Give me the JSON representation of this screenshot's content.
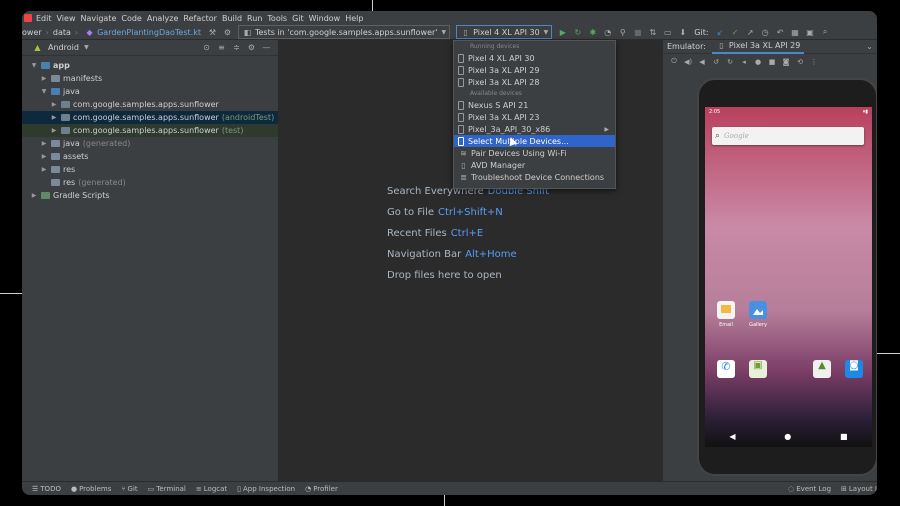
{
  "menu": [
    "Edit",
    "View",
    "Navigate",
    "Code",
    "Analyze",
    "Refactor",
    "Build",
    "Run",
    "Tools",
    "Git",
    "Window",
    "Help"
  ],
  "toolbar": {
    "crumbs": [
      "ower",
      "data"
    ],
    "file_crumb": "GardenPlantingDaoTest.kt",
    "run_config": "Tests in 'com.google.samples.apps.sunflower'",
    "device_combo": "Pixel 4 XL API 30",
    "git_label": "Git:"
  },
  "project": {
    "view_label": "Android",
    "tree": [
      {
        "label": "app",
        "suffix": ""
      },
      {
        "label": "manifests",
        "suffix": ""
      },
      {
        "label": "java",
        "suffix": ""
      },
      {
        "label": "com.google.samples.apps.sunflower",
        "suffix": ""
      },
      {
        "label": "com.google.samples.apps.sunflower",
        "suffix": "(androidTest)"
      },
      {
        "label": "com.google.samples.apps.sunflower",
        "suffix": "(test)"
      },
      {
        "label": "java",
        "suffix": "(generated)"
      },
      {
        "label": "assets",
        "suffix": ""
      },
      {
        "label": "res",
        "suffix": ""
      },
      {
        "label": "res",
        "suffix": "(generated)"
      },
      {
        "label": "Gradle Scripts",
        "suffix": ""
      }
    ]
  },
  "editor": {
    "hints": [
      {
        "label": "Search Everywhere",
        "key": "Double Shift"
      },
      {
        "label": "Go to File",
        "key": "Ctrl+Shift+N"
      },
      {
        "label": "Recent Files",
        "key": "Ctrl+E"
      },
      {
        "label": "Navigation Bar",
        "key": "Alt+Home"
      },
      {
        "label": "Drop files here to open",
        "key": ""
      }
    ]
  },
  "dropdown": {
    "running_label": "Running devices",
    "running": [
      "Pixel 4 XL API 30",
      "Pixel 3a XL API 29",
      "Pixel 3a XL API 28"
    ],
    "available_label": "Available devices",
    "available": [
      "Nexus S API 21",
      "Pixel 3a XL API 23",
      "Pixel_3a_API_30_x86"
    ],
    "actions": [
      "Select Multiple Devices...",
      "Pair Devices Using Wi-Fi",
      "AVD Manager",
      "Troubleshoot Device Connections"
    ]
  },
  "emulator": {
    "title": "Emulator:",
    "device_tab": "Pixel 3a XL API 29",
    "clock": "2:05",
    "search_placeholder": "Google",
    "apps": {
      "email": "Email",
      "gallery": "Gallery"
    }
  },
  "bottombar": {
    "items": [
      "TODO",
      "Problems",
      "Git",
      "Terminal",
      "Logcat",
      "App Inspection",
      "Profiler"
    ],
    "right": [
      "Event Log",
      "Layout I"
    ]
  },
  "colors": {
    "accent": "#2f65ca",
    "link": "#589df6",
    "run": "#59a869"
  }
}
